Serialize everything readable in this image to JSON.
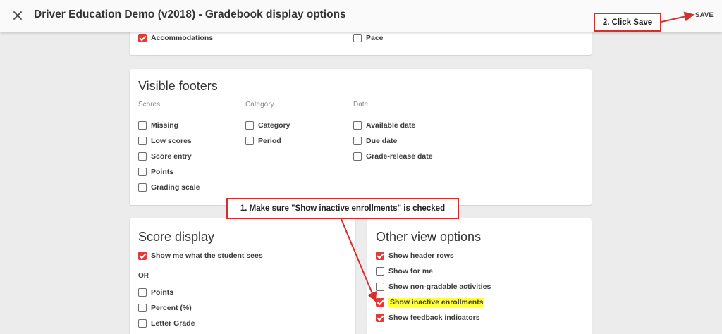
{
  "header": {
    "title": "Driver Education Demo (v2018) - Gradebook display options",
    "save_label": "SAVE",
    "close_icon": "close-icon"
  },
  "top_section": {
    "items": [
      {
        "label": "Accommodations",
        "checked": true
      },
      {
        "label": "Pace",
        "checked": false
      }
    ]
  },
  "visible_footers": {
    "title": "Visible footers",
    "columns": [
      {
        "heading": "Scores",
        "items": [
          {
            "label": "Missing",
            "checked": false
          },
          {
            "label": "Low scores",
            "checked": false
          },
          {
            "label": "Score entry",
            "checked": false
          },
          {
            "label": "Points",
            "checked": false
          },
          {
            "label": "Grading scale",
            "checked": false
          }
        ]
      },
      {
        "heading": "Category",
        "items": [
          {
            "label": "Category",
            "checked": false
          },
          {
            "label": "Period",
            "checked": false
          }
        ]
      },
      {
        "heading": "Date",
        "items": [
          {
            "label": "Available date",
            "checked": false
          },
          {
            "label": "Due date",
            "checked": false
          },
          {
            "label": "Grade-release date",
            "checked": false
          }
        ]
      }
    ]
  },
  "score_display": {
    "title": "Score display",
    "first_item": {
      "label": "Show me what the student sees",
      "checked": true
    },
    "or_label": "OR",
    "items": [
      {
        "label": "Points",
        "checked": false
      },
      {
        "label": "Percent (%)",
        "checked": false
      },
      {
        "label": "Letter Grade",
        "checked": false
      }
    ]
  },
  "other_view_options": {
    "title": "Other view options",
    "items": [
      {
        "label": "Show header rows",
        "checked": true
      },
      {
        "label": "Show for me",
        "checked": false
      },
      {
        "label": "Show non-gradable activities",
        "checked": false
      },
      {
        "label": "Show inactive enrollments",
        "checked": true
      },
      {
        "label": "Show feedback indicators",
        "checked": true
      }
    ]
  },
  "annotations": {
    "callout_1": "1. Make sure \"Show inactive enrollments\" is checked",
    "callout_2": "2. Click Save",
    "color": "#d32f2f",
    "highlight_color": "#ffff3a"
  },
  "colors": {
    "accent": "#e53935",
    "background": "#ececec",
    "card": "#ffffff"
  }
}
